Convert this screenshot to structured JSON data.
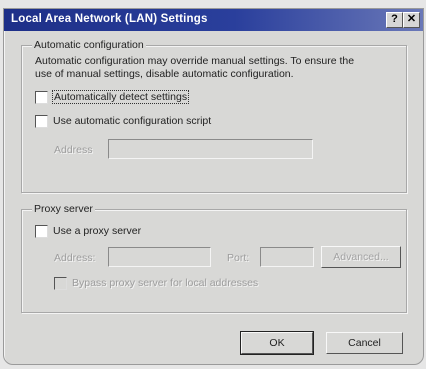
{
  "window": {
    "title": "Local Area Network (LAN) Settings",
    "help_label": "?",
    "close_label": "✕"
  },
  "auto_config": {
    "legend": "Automatic configuration",
    "description_line1": "Automatic configuration may override manual settings.  To ensure the",
    "description_line2": "use of manual settings, disable automatic configuration.",
    "detect_label": "Automatically detect settings",
    "detect_checked": false,
    "script_label": "Use automatic configuration script",
    "script_checked": false,
    "address_label": "Address",
    "address_value": ""
  },
  "proxy": {
    "legend": "Proxy server",
    "use_proxy_label": "Use a proxy server",
    "use_proxy_checked": false,
    "address_label": "Address:",
    "address_value": "",
    "port_label": "Port:",
    "port_value": "",
    "advanced_label": "Advanced...",
    "bypass_label": "Bypass proxy server for local addresses",
    "bypass_checked": false
  },
  "buttons": {
    "ok_label": "OK",
    "cancel_label": "Cancel"
  }
}
